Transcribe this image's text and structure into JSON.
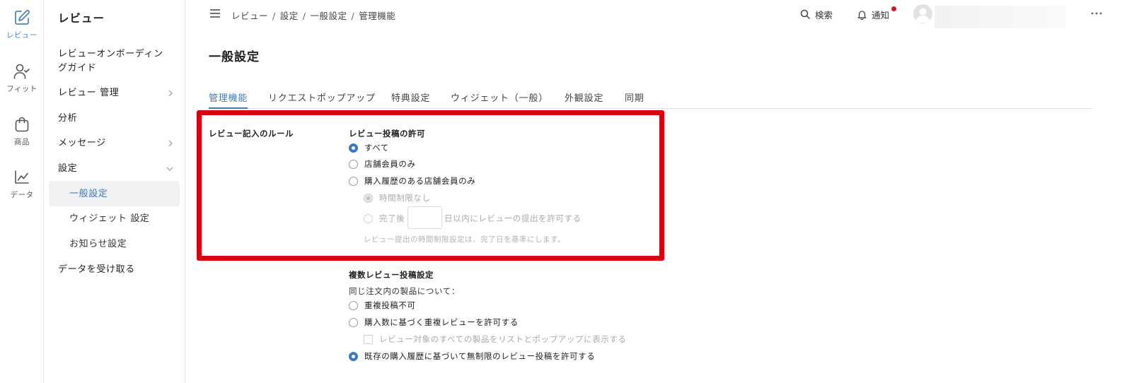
{
  "rail": {
    "items": [
      {
        "label": "レビュー",
        "icon": "edit-icon"
      },
      {
        "label": "フィット",
        "icon": "user-check-icon"
      },
      {
        "label": "商品",
        "icon": "shopping-bag-icon"
      },
      {
        "label": "データ",
        "icon": "chart-icon"
      }
    ]
  },
  "sidebar": {
    "title": "レビュー",
    "items": [
      {
        "label": "レビューオンボーディングガイド"
      },
      {
        "label": "レビュー 管理"
      },
      {
        "label": "分析"
      },
      {
        "label": "メッセージ"
      },
      {
        "label": "設定"
      },
      {
        "label": "一般設定"
      },
      {
        "label": "ウィジェット 設定"
      },
      {
        "label": "お知らせ設定"
      },
      {
        "label": "データを受け取る"
      }
    ]
  },
  "header": {
    "breadcrumbs": [
      "レビュー",
      "設定",
      "一般設定",
      "管理機能"
    ],
    "search_label": "検索",
    "notify_label": "通知"
  },
  "page": {
    "title": "一般設定",
    "tabs": [
      "管理機能",
      "リクエストポップアップ",
      "特典設定",
      "ウィジェット（一般）",
      "外観設定",
      "同期"
    ],
    "active_tab": "管理機能"
  },
  "rules": {
    "section_label": "レビュー記入のルール",
    "permission": {
      "title": "レビュー投稿の許可",
      "options": [
        "すべて",
        "店舗会員のみ",
        "購入履歴のある店舗会員のみ"
      ],
      "selected": "すべて",
      "sub_options": [
        "時間制限なし",
        "完了後",
        "日以内にレビューの提出を許可する"
      ],
      "days_value": "",
      "hint": "レビュー提出の時間制限設定は、完了日を基準にします。"
    },
    "multi": {
      "title": "複数レビュー投稿設定",
      "subtitle": "同じ注文内の製品について：",
      "options": [
        "重複投稿不可",
        "購入数に基づく重複レビューを許可する",
        "既存の購入履歴に基づいて無制限のレビュー投稿を許可する"
      ],
      "checkbox_label": "レビュー対象のすべての製品をリストとポップアップに表示する",
      "selected": "既存の購入履歴に基づいて無制限のレビュー投稿を許可する"
    }
  },
  "colors": {
    "accent": "#3a7bc0",
    "highlight": "#d90010",
    "notify_dot": "#d9131f"
  }
}
